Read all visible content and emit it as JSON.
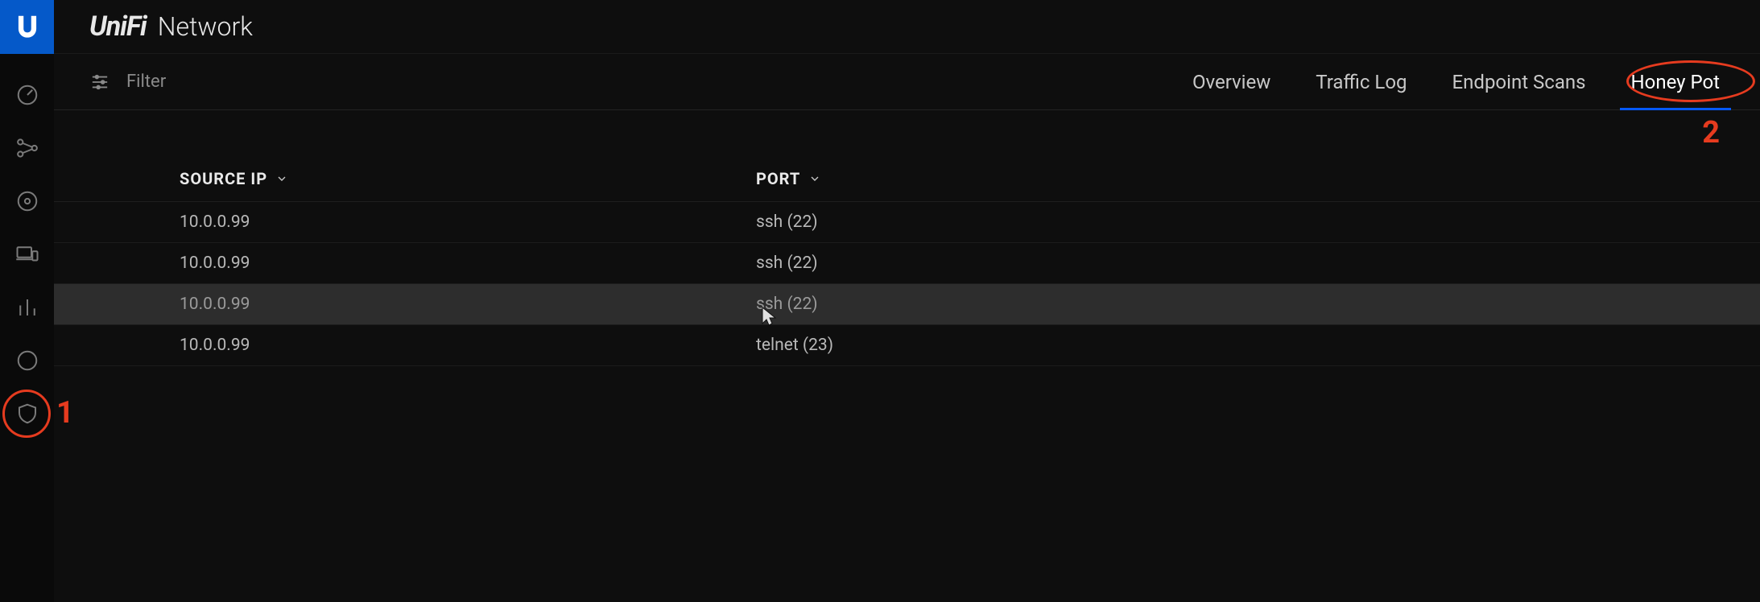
{
  "brand": {
    "name": "UniFi",
    "product": "Network"
  },
  "sidebar": {
    "items": [
      {
        "name": "dashboard",
        "icon": "gauge-icon"
      },
      {
        "name": "topology",
        "icon": "network-icon"
      },
      {
        "name": "devices",
        "icon": "circle-dot-icon"
      },
      {
        "name": "clients",
        "icon": "laptop-mobile-icon"
      },
      {
        "name": "statistics",
        "icon": "bars-icon"
      },
      {
        "name": "wifi-insights",
        "icon": "globe-icon"
      },
      {
        "name": "security",
        "icon": "shield-icon"
      }
    ]
  },
  "toolbar": {
    "filter_label": "Filter",
    "tabs": [
      {
        "label": "Overview",
        "active": false
      },
      {
        "label": "Traffic Log",
        "active": false
      },
      {
        "label": "Endpoint Scans",
        "active": false
      },
      {
        "label": "Honey Pot",
        "active": true
      }
    ]
  },
  "table": {
    "columns": {
      "source_ip": "SOURCE IP",
      "port": "PORT"
    },
    "rows": [
      {
        "source_ip": "10.0.0.99",
        "port": "ssh (22)",
        "hover": false
      },
      {
        "source_ip": "10.0.0.99",
        "port": "ssh (22)",
        "hover": false
      },
      {
        "source_ip": "10.0.0.99",
        "port": "ssh (22)",
        "hover": true
      },
      {
        "source_ip": "10.0.0.99",
        "port": "telnet (23)",
        "hover": false
      }
    ]
  },
  "annotations": {
    "sidebar_num": "1",
    "tab_num": "2"
  },
  "cursor_text": ""
}
